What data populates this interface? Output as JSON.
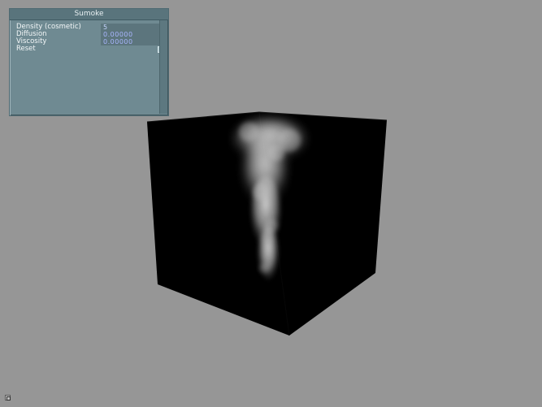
{
  "panel": {
    "title": "Sumoke",
    "rows": [
      {
        "label": "Density (cosmetic)",
        "value": "5"
      },
      {
        "label": "Diffusion",
        "value": "0.00000"
      },
      {
        "label": "Viscosity",
        "value": "0.00000"
      },
      {
        "label": "Reset"
      }
    ]
  },
  "colors": {
    "background": "#969696",
    "panel": "#6f8a92",
    "cube": "#000000",
    "smoke": "#d8d8d8"
  },
  "icons": {
    "corner": "window-resize-icon"
  }
}
